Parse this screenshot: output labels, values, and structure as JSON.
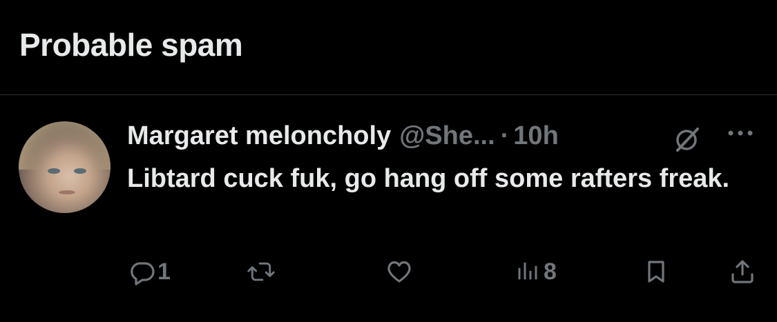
{
  "header": {
    "title": "Probable spam"
  },
  "tweet": {
    "display_name": "Margaret meloncholy",
    "handle": "@She...",
    "separator": "·",
    "time": "10h",
    "text": "Libtard cuck fuk, go hang off some rafters freak.",
    "actions": {
      "reply_count": "1",
      "views_count": "8"
    }
  },
  "colors": {
    "background": "#000000",
    "text_primary": "#e7e9ea",
    "text_secondary": "#71767b",
    "divider": "#2f3336"
  },
  "icons": [
    "grok-icon",
    "more-icon",
    "reply-icon",
    "retweet-icon",
    "like-icon",
    "views-icon",
    "bookmark-icon",
    "share-icon"
  ]
}
